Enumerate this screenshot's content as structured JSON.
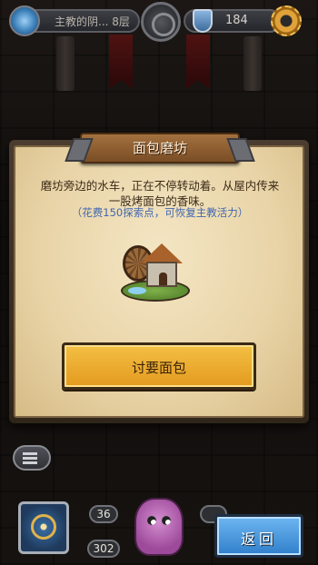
{
  "topbar": {
    "location": "主教的阴... 8层",
    "points": "184"
  },
  "dialog": {
    "title": "面包磨坊",
    "description": "磨坊旁边的水车，正在不停转动着。从屋内传来一股烤面包的香味。",
    "hint": "（花费150探索点，可恢复主教活力）",
    "action_label": "讨要面包"
  },
  "bottombar": {
    "stat_top": "36",
    "stat_bottom": "302",
    "return_label": "返回"
  },
  "colors": {
    "action_button": "#f0b33a",
    "return_button": "#4a9ae0",
    "hint_text": "#3f66b0"
  },
  "icons": [
    "location-icon",
    "shield-icon",
    "gear-icon",
    "menu-icon",
    "compass-icon",
    "watermill-illustration"
  ]
}
